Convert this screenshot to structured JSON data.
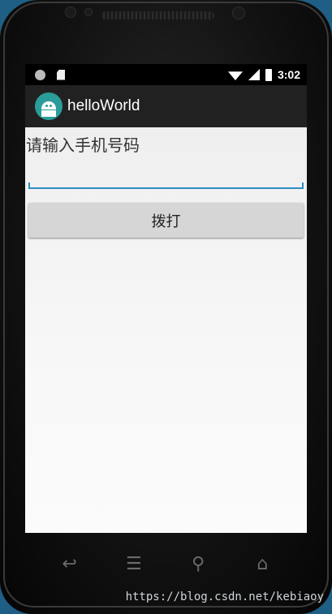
{
  "status_bar": {
    "time": "3:02",
    "icons": [
      "status-circle-icon",
      "sd-card-icon",
      "wifi-icon",
      "signal-icon",
      "battery-icon"
    ]
  },
  "action_bar": {
    "title": "helloWorld",
    "icon": "android-icon",
    "icon_color": "#2a9d99"
  },
  "form": {
    "prompt_label": "请输入手机号码",
    "phone_input_value": "",
    "dial_button_label": "拨打"
  },
  "nav_bar": {
    "back_glyph": "↩",
    "menu_glyph": "☰",
    "search_glyph": "⚲",
    "home_glyph": "⌂"
  },
  "watermark": "https://blog.csdn.net/kebiaoy",
  "colors": {
    "accent": "#2f8ec2",
    "button_bg": "#d6d6d6",
    "action_bar_bg": "#212121"
  }
}
